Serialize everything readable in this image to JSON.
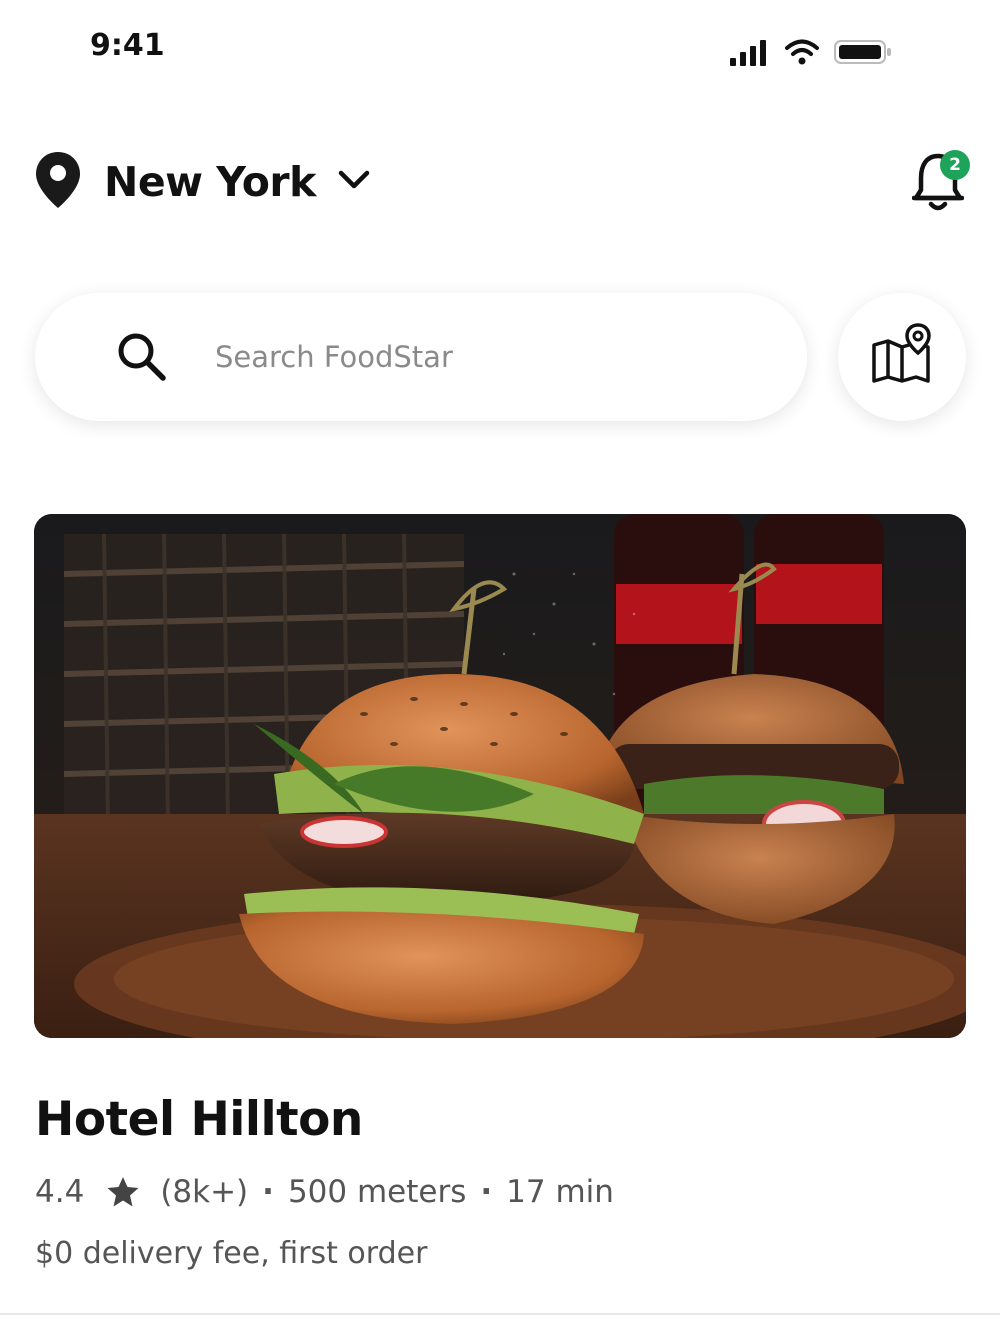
{
  "status_bar": {
    "time": "9:41",
    "icons": [
      "signal-icon",
      "wifi-icon",
      "battery-icon"
    ]
  },
  "header": {
    "location": "New York",
    "location_icon": "map-pin-icon",
    "dropdown_icon": "chevron-down-icon",
    "notifications_icon": "bell-icon",
    "notification_count": "2"
  },
  "search": {
    "placeholder": "Search FoodStar",
    "value": ""
  },
  "map_button_icon": "map-pin-icon",
  "restaurant": {
    "image": "burger-photo",
    "name": "Hotel Hillton",
    "rating": "4.4",
    "reviews": "(8k+)",
    "distance": "500 meters",
    "time": "17 min",
    "delivery_note": "$0 delivery fee, first order"
  },
  "colors": {
    "badge": "#1ea35a",
    "text_primary": "#111111",
    "text_secondary": "#555555"
  }
}
